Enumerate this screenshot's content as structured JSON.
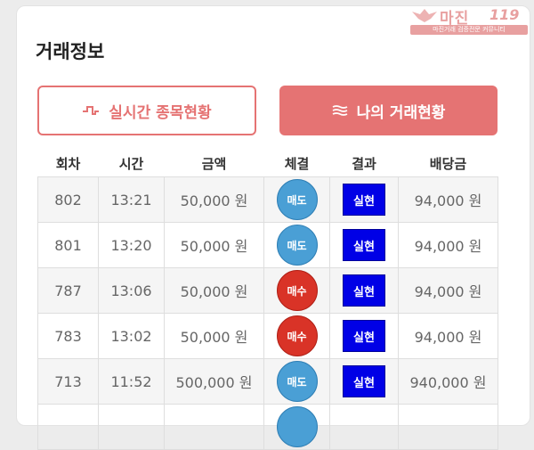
{
  "watermark": {
    "name": "마진",
    "number": "119",
    "tagline": "마진거래 검증전문 커뮤니티"
  },
  "section": {
    "title": "거래정보"
  },
  "buttons": {
    "realtime": {
      "icon": "pulse-icon",
      "label": "실시간 종목현황"
    },
    "my_trades": {
      "icon": "menu-lines-icon",
      "label": "나의 거래현황"
    }
  },
  "colors": {
    "accent": "#e57373",
    "sell": "#4a9fd5",
    "buy": "#d93327",
    "result": "#0000e6"
  },
  "table": {
    "headers": [
      "회차",
      "시간",
      "금액",
      "체결",
      "결과",
      "배당금"
    ],
    "rows": [
      {
        "round": "802",
        "time": "13:21",
        "amount": "50,000 원",
        "fill": "매도",
        "fill_type": "sell",
        "result": "실현",
        "payout": "94,000 원"
      },
      {
        "round": "801",
        "time": "13:20",
        "amount": "50,000 원",
        "fill": "매도",
        "fill_type": "sell",
        "result": "실현",
        "payout": "94,000 원"
      },
      {
        "round": "787",
        "time": "13:06",
        "amount": "50,000 원",
        "fill": "매수",
        "fill_type": "buy",
        "result": "실현",
        "payout": "94,000 원"
      },
      {
        "round": "783",
        "time": "13:02",
        "amount": "50,000 원",
        "fill": "매수",
        "fill_type": "buy",
        "result": "실현",
        "payout": "94,000 원"
      },
      {
        "round": "713",
        "time": "11:52",
        "amount": "500,000 원",
        "fill": "매도",
        "fill_type": "sell",
        "result": "실현",
        "payout": "940,000 원"
      },
      {
        "round": "",
        "time": "",
        "amount": "",
        "fill": "",
        "fill_type": "sell",
        "result": "",
        "payout": ""
      }
    ]
  }
}
